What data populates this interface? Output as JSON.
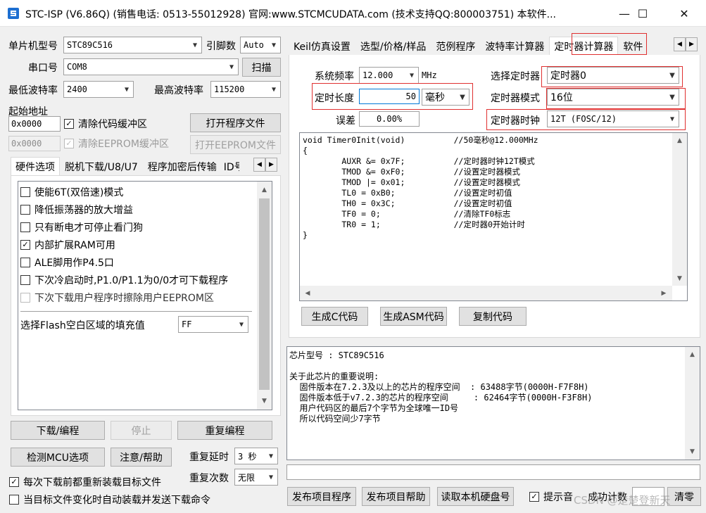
{
  "window": {
    "title": "STC-ISP (V6.86Q) (销售电话: 0513-55012928) 官网:www.STCMCUDATA.com  (技术支持QQ:800003751) 本软件...",
    "minimize": "—",
    "maximize": "☐",
    "close": "✕"
  },
  "left": {
    "mcu_type_label": "单片机型号",
    "mcu_type_value": "STC89C516",
    "pins_label": "引脚数",
    "pins_value": "Auto",
    "port_label": "串口号",
    "port_value": "COM8",
    "scan_button": "扫描",
    "min_baud_label": "最低波特率",
    "min_baud_value": "2400",
    "max_baud_label": "最高波特率",
    "max_baud_value": "115200",
    "start_addr_label": "起始地址",
    "start_addr_1": "0x0000",
    "clear_code_buffer": "清除代码缓冲区",
    "open_program_file": "打开程序文件",
    "start_addr_2": "0x0000",
    "clear_eeprom_buffer": "清除EEPROM缓冲区",
    "open_eeprom_file": "打开EEPROM文件",
    "tabs": [
      "硬件选项",
      "脱机下载/U8/U7",
      "程序加密后传输",
      "ID号"
    ],
    "options": [
      {
        "label": "使能6T(双倍速)模式",
        "checked": false,
        "enabled": true
      },
      {
        "label": "降低振荡器的放大增益",
        "checked": false,
        "enabled": true
      },
      {
        "label": "只有断电才可停止看门狗",
        "checked": false,
        "enabled": true
      },
      {
        "label": "内部扩展RAM可用",
        "checked": true,
        "enabled": true
      },
      {
        "label": "ALE脚用作P4.5口",
        "checked": false,
        "enabled": true
      },
      {
        "label": "下次冷启动时,P1.0/P1.1为0/0才可下载程序",
        "checked": false,
        "enabled": true
      },
      {
        "label": "下次下载用户程序时擦除用户EEPROM区",
        "checked": false,
        "enabled": false
      }
    ],
    "flash_fill_label": "选择Flash空白区域的填充值",
    "flash_fill_value": "FF",
    "download_button": "下载/编程",
    "stop_button": "停止",
    "reprogram_button": "重复编程",
    "check_mcu_button": "检测MCU选项",
    "help_button": "注意/帮助",
    "repeat_delay_label": "重复延时",
    "repeat_delay_value": "3 秒",
    "repeat_count_label": "重复次数",
    "repeat_count_value": "无限",
    "reload_before_download": "每次下载前都重新装载目标文件",
    "auto_reload_on_change": "当目标文件变化时自动装载并发送下载命令"
  },
  "right": {
    "tabs": [
      "Keil仿真设置",
      "选型/价格/样品",
      "范例程序",
      "波特率计算器",
      "定时器计算器",
      "软件"
    ],
    "active_tab": 4,
    "sys_freq_label": "系统频率",
    "sys_freq_value": "12.000",
    "sys_freq_unit": "MHz",
    "timer_len_label": "定时长度",
    "timer_len_value": "50",
    "timer_len_unit": "毫秒",
    "error_label": "误差",
    "error_value": "0.00%",
    "select_timer_label": "选择定时器",
    "select_timer_value": "定时器0",
    "timer_mode_label": "定时器模式",
    "timer_mode_value": "16位",
    "timer_clock_label": "定时器时钟",
    "timer_clock_value": "12T (FOSC/12)",
    "code_lines": [
      "void Timer0Init(void)          //50毫秒@12.000MHz",
      "{",
      "        AUXR &= 0x7F;          //定时器时钟12T模式",
      "        TMOD &= 0xF0;          //设置定时器模式",
      "        TMOD |= 0x01;          //设置定时器模式",
      "        TL0 = 0xB0;            //设置定时初值",
      "        TH0 = 0x3C;            //设置定时初值",
      "        TF0 = 0;               //清除TF0标志",
      "        TR0 = 1;               //定时器0开始计时",
      "}"
    ],
    "gen_c_button": "生成C代码",
    "gen_asm_button": "生成ASM代码",
    "copy_code_button": "复制代码",
    "info_lines": [
      "芯片型号 : STC89C516",
      "",
      "关于此芯片的重要说明:",
      "  固件版本在7.2.3及以上的芯片的程序空间  : 63488字节(0000H-F7F8H)",
      "  固件版本低于v7.2.3的芯片的程序空间     : 62464字节(0000H-F3F8H)",
      "  用户代码区的最后7个字节为全球唯一ID号",
      "  所以代码空间少7字节"
    ],
    "publish_program_button": "发布项目程序",
    "publish_help_button": "发布项目帮助",
    "read_disk_button": "读取本机硬盘号",
    "prompt_sound_label": "提示音",
    "success_count_label": "成功计数",
    "clear_button": "清零",
    "watermark": "CSDN @楚楚登新天"
  },
  "colors": {
    "highlight_box": "#e03030",
    "window_bg": "#f0f0f0"
  }
}
